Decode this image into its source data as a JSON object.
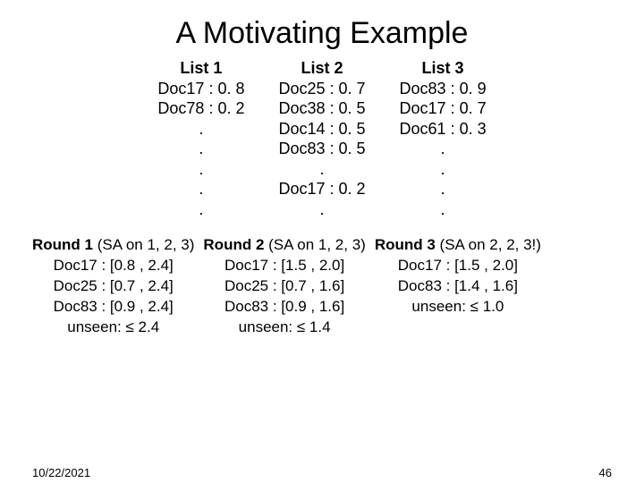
{
  "title": "A Motivating Example",
  "lists": [
    {
      "header": "List 1",
      "rows": [
        "Doc17 : 0. 8",
        "Doc78 : 0. 2",
        ".",
        ".",
        ".",
        ".",
        "."
      ]
    },
    {
      "header": "List 2",
      "rows": [
        "Doc25 : 0. 7",
        "Doc38 : 0. 5",
        "Doc14 : 0. 5",
        "Doc83 : 0. 5",
        ".",
        "Doc17 : 0. 2",
        "."
      ]
    },
    {
      "header": "List 3",
      "rows": [
        "Doc83 : 0. 9",
        "Doc17 : 0. 7",
        "Doc61 : 0. 3",
        ".",
        ".",
        ".",
        "."
      ]
    }
  ],
  "rounds": [
    {
      "header_bold": "Round 1",
      "header_rest": " (SA on 1, 2, 3)",
      "rows": [
        "Doc17 : [0.8 , 2.4]",
        "Doc25 : [0.7 , 2.4]",
        "Doc83 : [0.9 , 2.4]",
        "unseen: ≤ 2.4"
      ]
    },
    {
      "header_bold": "Round 2",
      "header_rest": " (SA on 1, 2, 3)",
      "rows": [
        "Doc17 : [1.5 , 2.0]",
        "Doc25 : [0.7 , 1.6]",
        "Doc83 : [0.9 , 1.6]",
        "unseen: ≤ 1.4"
      ]
    },
    {
      "header_bold": "Round 3",
      "header_rest": " (SA on 2, 2, 3!)",
      "rows": [
        "Doc17 : [1.5 , 2.0]",
        "Doc83 : [1.4 , 1.6]",
        "unseen: ≤ 1.0"
      ]
    }
  ],
  "footer": {
    "date": "10/22/2021",
    "page": "46"
  }
}
